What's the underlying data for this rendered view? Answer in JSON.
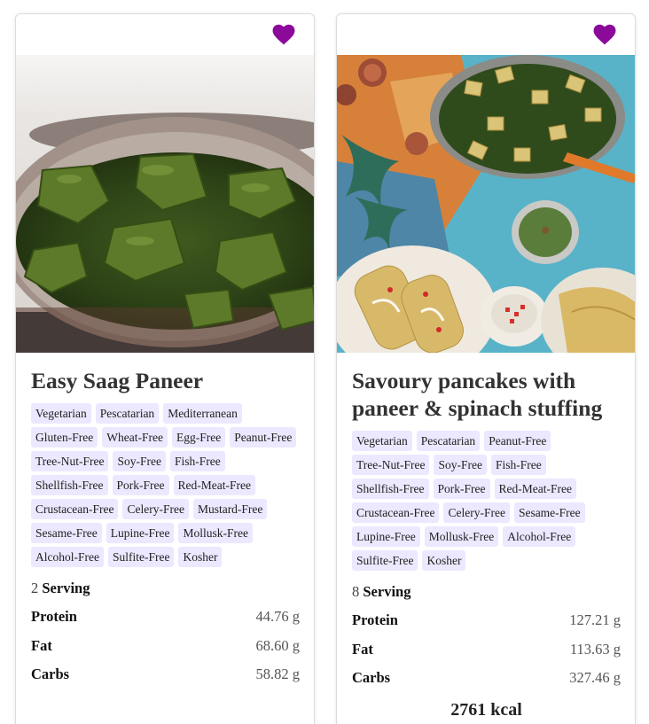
{
  "recipes": [
    {
      "title": "Easy Saag Paneer",
      "tags": [
        "Vegetarian",
        "Pescatarian",
        "Mediterranean",
        "Gluten-Free",
        "Wheat-Free",
        "Egg-Free",
        "Peanut-Free",
        "Tree-Nut-Free",
        "Soy-Free",
        "Fish-Free",
        "Shellfish-Free",
        "Pork-Free",
        "Red-Meat-Free",
        "Crustacean-Free",
        "Celery-Free",
        "Mustard-Free",
        "Sesame-Free",
        "Lupine-Free",
        "Mollusk-Free",
        "Alcohol-Free",
        "Sulfite-Free",
        "Kosher"
      ],
      "servings": "2",
      "serving_label": "Serving",
      "nutrients": [
        {
          "label": "Protein",
          "value": "44.76 g"
        },
        {
          "label": "Fat",
          "value": "68.60 g"
        },
        {
          "label": "Carbs",
          "value": "58.82 g"
        }
      ],
      "kcal": "",
      "favorite_icon": "heart-icon",
      "favorite_color": "#8b0a9a"
    },
    {
      "title": "Savoury pancakes with paneer & spinach stuffing",
      "tags": [
        "Vegetarian",
        "Pescatarian",
        "Peanut-Free",
        "Tree-Nut-Free",
        "Soy-Free",
        "Fish-Free",
        "Shellfish-Free",
        "Pork-Free",
        "Red-Meat-Free",
        "Crustacean-Free",
        "Celery-Free",
        "Sesame-Free",
        "Lupine-Free",
        "Mollusk-Free",
        "Alcohol-Free",
        "Sulfite-Free",
        "Kosher"
      ],
      "servings": "8",
      "serving_label": "Serving",
      "nutrients": [
        {
          "label": "Protein",
          "value": "127.21 g"
        },
        {
          "label": "Fat",
          "value": "113.63 g"
        },
        {
          "label": "Carbs",
          "value": "327.46 g"
        }
      ],
      "kcal": "2761 kcal",
      "favorite_icon": "heart-icon",
      "favorite_color": "#8b0a9a"
    }
  ],
  "colors": {
    "tag_background": "#ece8ff",
    "card_border": "#dcdcdc"
  }
}
